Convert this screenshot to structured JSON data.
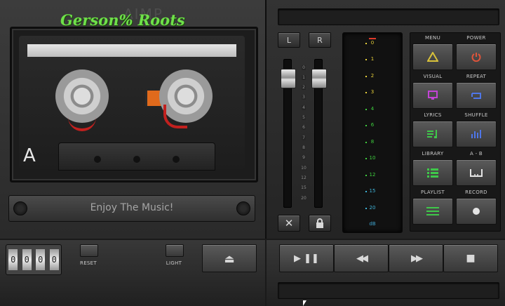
{
  "cassette": {
    "title": "Gerson% Roots",
    "brand": "AIMP",
    "side": "A",
    "message": "Enjoy The Music!"
  },
  "counter": {
    "digits": [
      "0",
      "0",
      "0",
      "0"
    ],
    "reset_label": "RESET",
    "light_label": "LIGHT"
  },
  "balance": {
    "left_label": "L",
    "right_label": "R"
  },
  "eq_scale": [
    "0",
    "1",
    "2",
    "3",
    "4",
    "5",
    "6",
    "7",
    "8",
    "9",
    "10",
    "12",
    "15",
    "20"
  ],
  "vu_scale": [
    "0",
    "1",
    "2",
    "3",
    "4",
    "6",
    "8",
    "10",
    "12",
    "15",
    "20",
    "dB"
  ],
  "buttons": [
    {
      "label": "MENU",
      "icon": "triangle-icon",
      "color": "#d9c23a"
    },
    {
      "label": "POWER",
      "icon": "power-icon",
      "color": "#e0543a"
    },
    {
      "label": "VISUAL",
      "icon": "monitor-icon",
      "color": "#c344d6"
    },
    {
      "label": "REPEAT",
      "icon": "repeat-icon",
      "color": "#4f76e8"
    },
    {
      "label": "LYRICS",
      "icon": "lyrics-icon",
      "color": "#3fc84a"
    },
    {
      "label": "SHUFFLE",
      "icon": "shuffle-icon",
      "color": "#4f76e8"
    },
    {
      "label": "LIBRARY",
      "icon": "library-icon",
      "color": "#3fc84a"
    },
    {
      "label": "A - B",
      "icon": "ab-icon",
      "color": "#e4e4e4"
    },
    {
      "label": "PLAYLIST",
      "icon": "playlist-icon",
      "color": "#3fc84a"
    },
    {
      "label": "RECORD",
      "icon": "record-icon",
      "color": "#e4e4e4"
    }
  ],
  "transport": {
    "play_pause": "▶ ❚❚",
    "prev": "◀◀",
    "next": "▶▶",
    "stop": "■",
    "eject": "⏏"
  },
  "colors": {
    "accent_green": "#6fe04a",
    "vu_yellow": "#e8d13a",
    "vu_green": "#3fd03f",
    "vu_red": "#e03a2a"
  }
}
